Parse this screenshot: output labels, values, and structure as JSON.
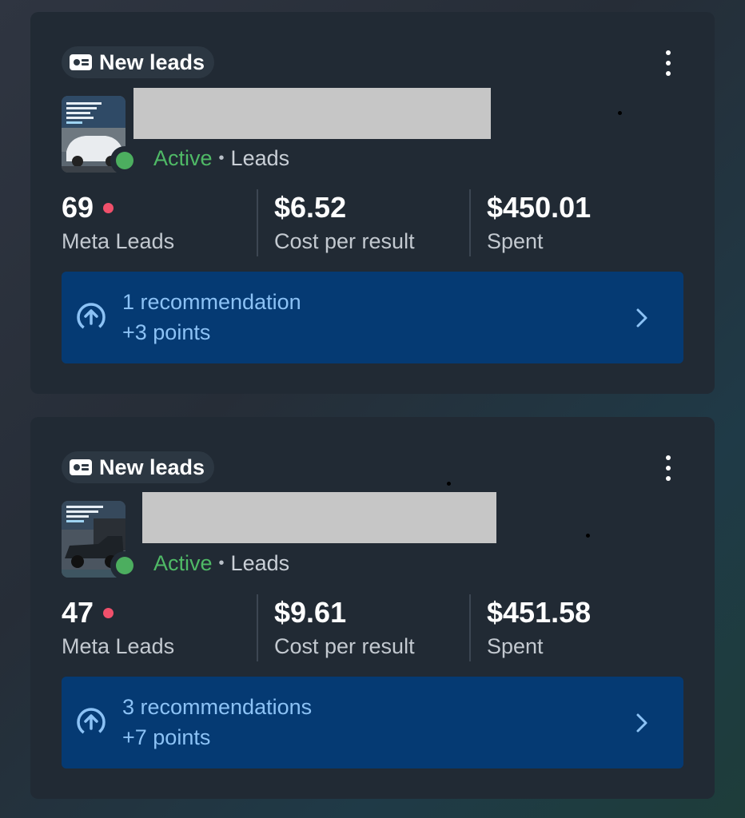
{
  "colors": {
    "card_background": "#212a34",
    "active_green": "#4fb966",
    "alert_red": "#f0506b",
    "recommendation_background": "#053a73",
    "recommendation_text": "#8cc2f5"
  },
  "campaigns": [
    {
      "objective_label": "New leads",
      "objective_icon": "contact-card-icon",
      "status": "Active",
      "separator": "•",
      "result_type": "Leads",
      "metrics": [
        {
          "value": "69",
          "label": "Meta Leads",
          "alert": true
        },
        {
          "value": "$6.52",
          "label": "Cost per result"
        },
        {
          "value": "$450.01",
          "label": "Spent"
        }
      ],
      "recommendation": {
        "title": "1 recommendation",
        "points": "+3 points",
        "icon": "arrow-up-circle-icon"
      }
    },
    {
      "objective_label": "New leads",
      "objective_icon": "contact-card-icon",
      "status": "Active",
      "separator": "•",
      "result_type": "Leads",
      "metrics": [
        {
          "value": "47",
          "label": "Meta Leads",
          "alert": true
        },
        {
          "value": "$9.61",
          "label": "Cost per result"
        },
        {
          "value": "$451.58",
          "label": "Spent"
        }
      ],
      "recommendation": {
        "title": "3 recommendations",
        "points": "+7 points",
        "icon": "arrow-up-circle-icon"
      }
    }
  ]
}
